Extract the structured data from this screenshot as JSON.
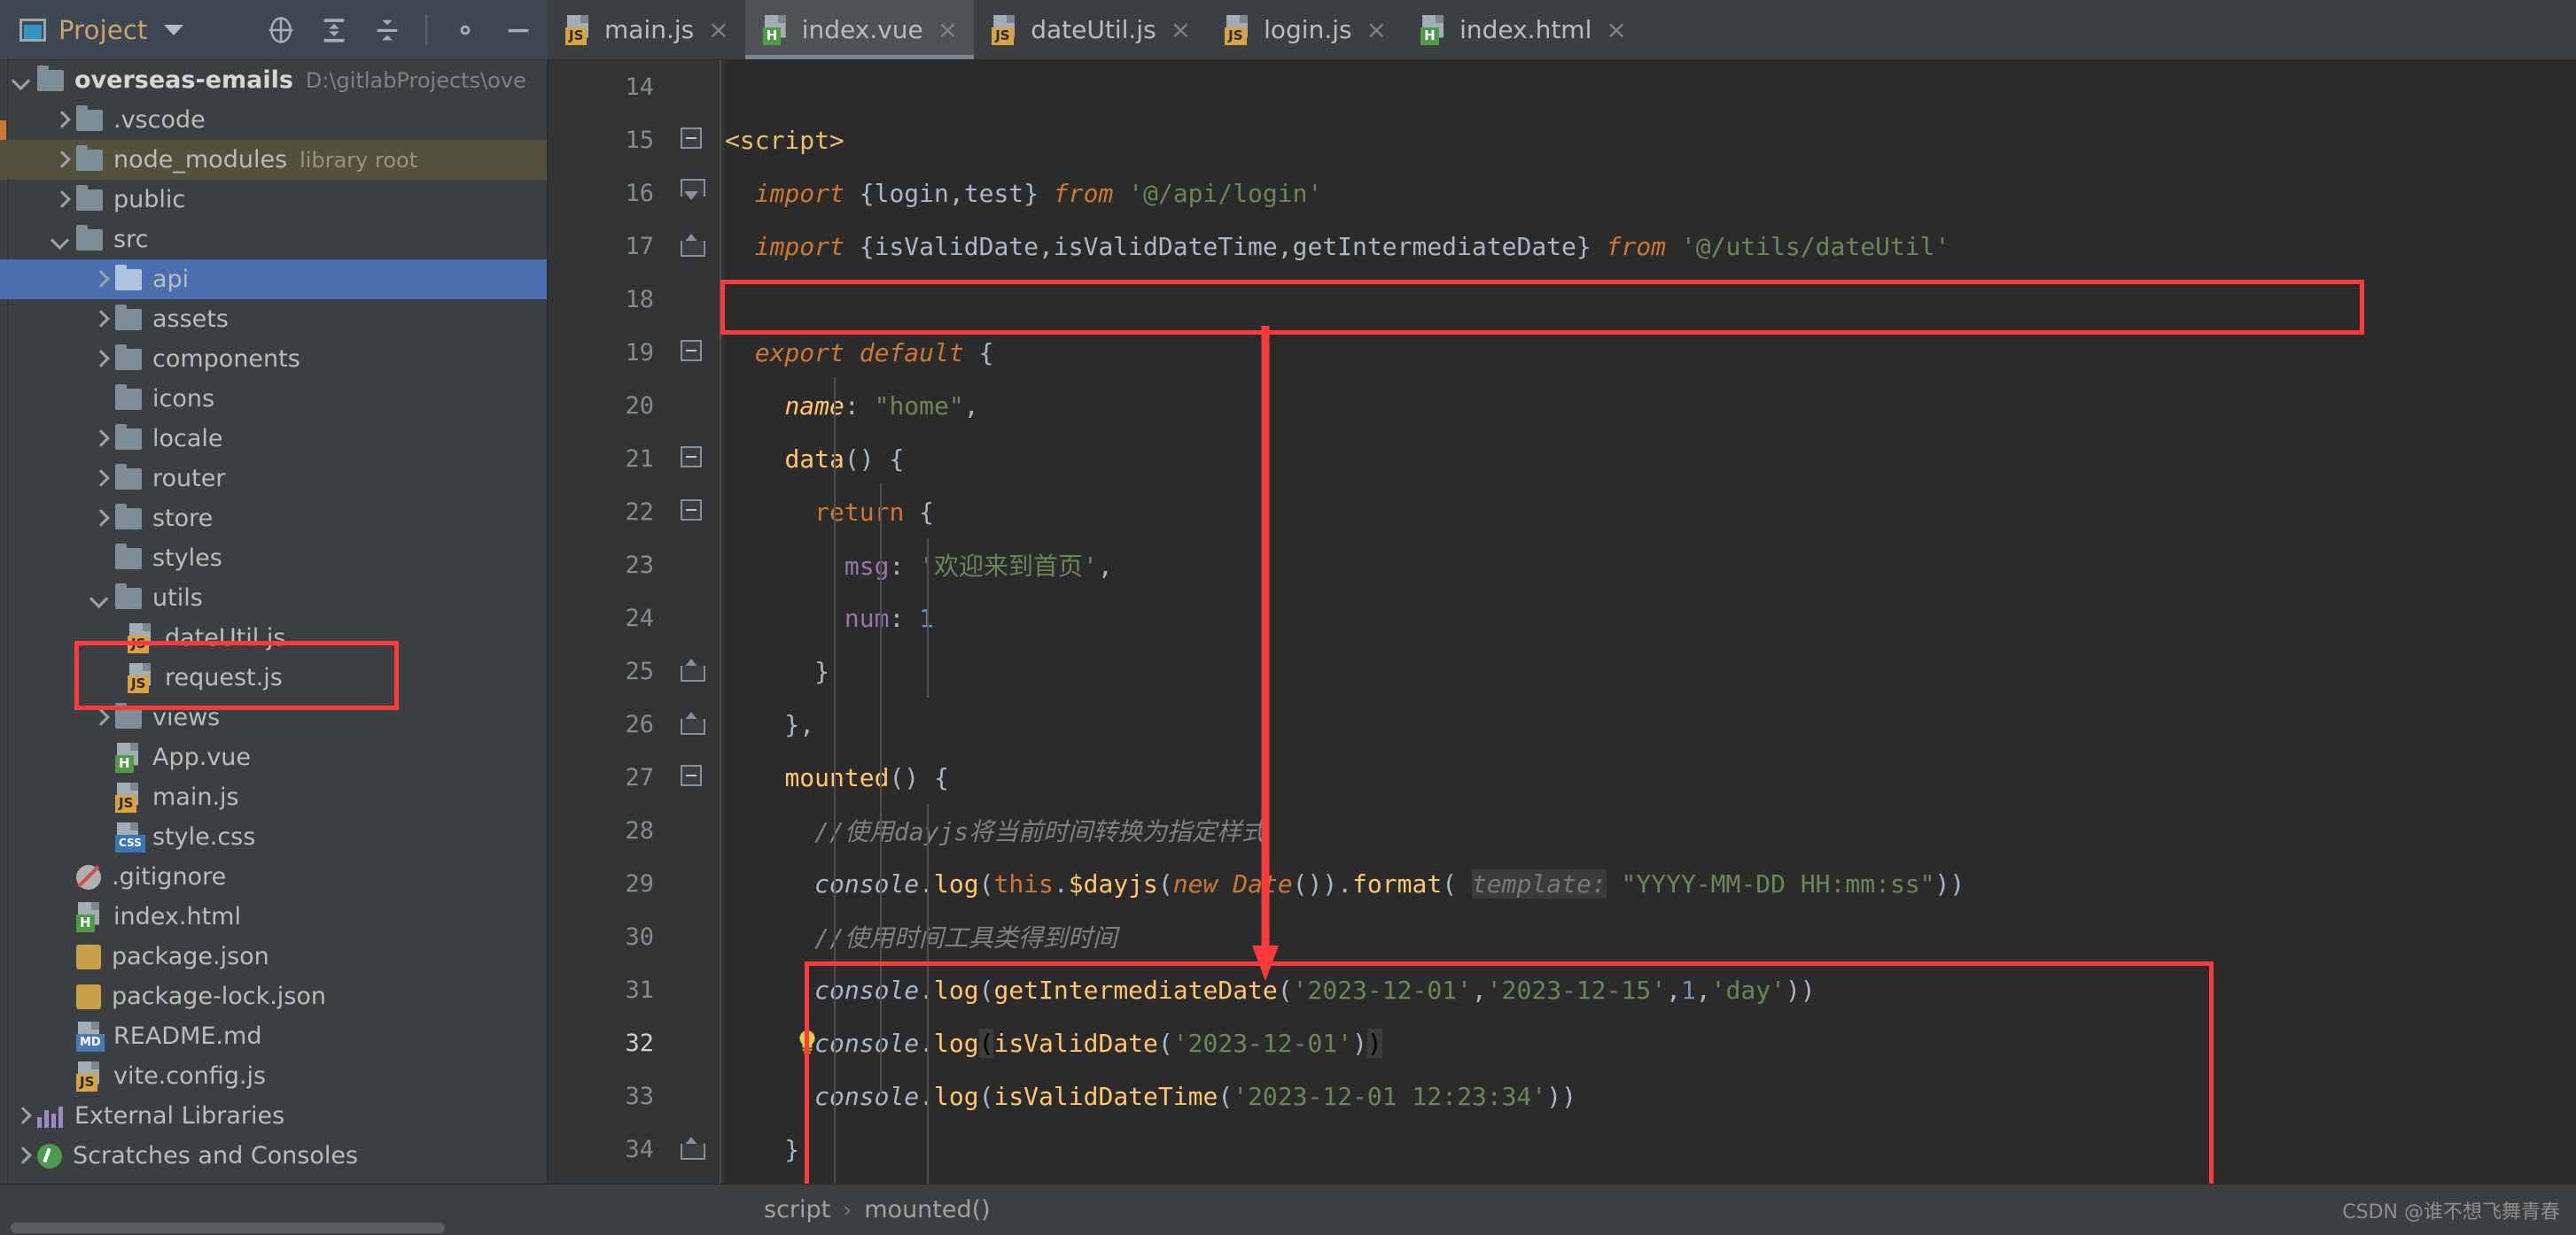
{
  "window": {
    "tool_window_title": "Project",
    "icons": {
      "project": "project-window-icon",
      "dropdown": "chevron-down-icon",
      "locate": "locate-target-icon",
      "expand_all": "expand-all-icon",
      "collapse_all": "collapse-all-icon",
      "settings": "gear-icon",
      "hide": "minimize-icon"
    }
  },
  "tabs": [
    {
      "label": "main.js",
      "type": "js",
      "badge": "JS",
      "active": false,
      "close": "×"
    },
    {
      "label": "index.vue",
      "type": "vue",
      "badge": "H",
      "active": true,
      "close": "×"
    },
    {
      "label": "dateUtil.js",
      "type": "js",
      "badge": "JS",
      "active": false,
      "close": "×"
    },
    {
      "label": "login.js",
      "type": "js",
      "badge": "JS",
      "active": false,
      "close": "×"
    },
    {
      "label": "index.html",
      "type": "html",
      "badge": "H",
      "active": false,
      "close": "×"
    }
  ],
  "tree": [
    {
      "name": "overseas-emails",
      "path": "D:\\gitlabProjects\\ove",
      "kind": "folder",
      "indent": 1,
      "arrow": "down",
      "root": true
    },
    {
      "name": ".vscode",
      "kind": "folder",
      "indent": 2,
      "arrow": "right"
    },
    {
      "name": "node_modules",
      "note": "library root",
      "kind": "folder",
      "indent": 2,
      "arrow": "right",
      "highlight": true
    },
    {
      "name": "public",
      "kind": "folder",
      "indent": 2,
      "arrow": "right"
    },
    {
      "name": "src",
      "kind": "folder",
      "indent": 2,
      "arrow": "down"
    },
    {
      "name": "api",
      "kind": "folder",
      "indent": 3,
      "arrow": "right",
      "selected": true
    },
    {
      "name": "assets",
      "kind": "folder",
      "indent": 3,
      "arrow": "right"
    },
    {
      "name": "components",
      "kind": "folder",
      "indent": 3,
      "arrow": "right"
    },
    {
      "name": "icons",
      "kind": "folder",
      "indent": 3,
      "arrow": "none"
    },
    {
      "name": "locale",
      "kind": "folder",
      "indent": 3,
      "arrow": "right"
    },
    {
      "name": "router",
      "kind": "folder",
      "indent": 3,
      "arrow": "right"
    },
    {
      "name": "store",
      "kind": "folder",
      "indent": 3,
      "arrow": "right"
    },
    {
      "name": "styles",
      "kind": "folder",
      "indent": 3,
      "arrow": "none"
    },
    {
      "name": "utils",
      "kind": "folder",
      "indent": 3,
      "arrow": "down"
    },
    {
      "name": "dateUtil.js",
      "kind": "js",
      "indent": 4,
      "arrow": "none"
    },
    {
      "name": "request.js",
      "kind": "js",
      "indent": 4,
      "arrow": "none"
    },
    {
      "name": "views",
      "kind": "folder",
      "indent": 3,
      "arrow": "right"
    },
    {
      "name": "App.vue",
      "kind": "vue",
      "indent": 3,
      "arrow": "none"
    },
    {
      "name": "main.js",
      "kind": "js",
      "indent": 3,
      "arrow": "none"
    },
    {
      "name": "style.css",
      "kind": "css",
      "indent": 3,
      "arrow": "none"
    },
    {
      "name": ".gitignore",
      "kind": "gitignore",
      "indent": 2,
      "arrow": "none"
    },
    {
      "name": "index.html",
      "kind": "html",
      "indent": 2,
      "arrow": "none"
    },
    {
      "name": "package.json",
      "kind": "json",
      "indent": 2,
      "arrow": "none"
    },
    {
      "name": "package-lock.json",
      "kind": "json",
      "indent": 2,
      "arrow": "none"
    },
    {
      "name": "README.md",
      "kind": "md",
      "indent": 2,
      "arrow": "none"
    },
    {
      "name": "vite.config.js",
      "kind": "js",
      "indent": 2,
      "arrow": "none"
    },
    {
      "name": "External Libraries",
      "kind": "lib",
      "indent": 1,
      "arrow": "right"
    },
    {
      "name": "Scratches and Consoles",
      "kind": "scratch",
      "indent": 1,
      "arrow": "none"
    }
  ],
  "editor": {
    "file": "index.vue",
    "lines": [
      {
        "n": "14",
        "fold": "none",
        "text": ""
      },
      {
        "n": "15",
        "fold": "minus",
        "text": "<script>"
      },
      {
        "n": "16",
        "fold": "arrow",
        "text": "  import {login,test} from '@/api/login'"
      },
      {
        "n": "17",
        "fold": "up",
        "text": "  import {isValidDate,isValidDateTime,getIntermediateDate} from '@/utils/dateUtil'"
      },
      {
        "n": "18",
        "fold": "none",
        "text": ""
      },
      {
        "n": "19",
        "fold": "minus",
        "text": "  export default {"
      },
      {
        "n": "20",
        "fold": "none",
        "text": "    name: \"home\","
      },
      {
        "n": "21",
        "fold": "minus",
        "text": "    data() {"
      },
      {
        "n": "22",
        "fold": "minus",
        "text": "      return {"
      },
      {
        "n": "23",
        "fold": "none",
        "text": "        msg: '欢迎来到首页',"
      },
      {
        "n": "24",
        "fold": "none",
        "text": "        num: 1"
      },
      {
        "n": "25",
        "fold": "up",
        "text": "      }"
      },
      {
        "n": "26",
        "fold": "up",
        "text": "    },"
      },
      {
        "n": "27",
        "fold": "minus",
        "text": "    mounted() {"
      },
      {
        "n": "28",
        "fold": "none",
        "text": "      //使用dayjs将当前时间转换为指定样式"
      },
      {
        "n": "29",
        "fold": "none",
        "text": "      console.log(this.$dayjs(new Date()).format( template: \"YYYY-MM-DD HH:mm:ss\"))"
      },
      {
        "n": "30",
        "fold": "none",
        "text": "      //使用时间工具类得到时间"
      },
      {
        "n": "31",
        "fold": "none",
        "text": "      console.log(getIntermediateDate('2023-12-01','2023-12-15',1,'day'))"
      },
      {
        "n": "32",
        "fold": "none",
        "text": "      console.log(isValidDate('2023-12-01'))",
        "bulb": true,
        "current": true
      },
      {
        "n": "33",
        "fold": "none",
        "text": "      console.log(isValidDateTime('2023-12-01 12:23:34'))"
      },
      {
        "n": "34",
        "fold": "up",
        "text": "    },"
      }
    ],
    "parameter_hint": "template:",
    "annotations": {
      "box_import_label": "highlight-import-dateUtil",
      "box_console_label": "highlight-console-calls",
      "box_utils_label": "highlight-utils-folder",
      "arrow_label": "red-arrow-connector",
      "color": "#fb3b3b"
    }
  },
  "status_bar": {
    "breadcrumbs": [
      "script",
      "mounted()"
    ],
    "separator": "›",
    "watermark": "CSDN @谁不想飞舞青春"
  }
}
